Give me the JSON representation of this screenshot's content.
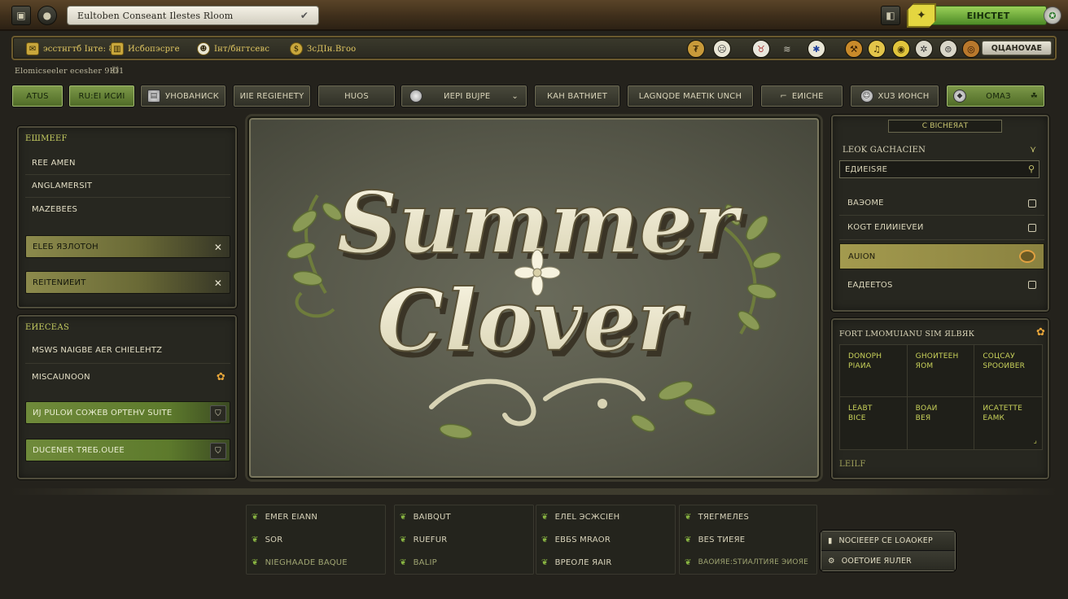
{
  "topbar": {
    "address": "Eultoben Conseant Ilestes Rloom",
    "action_button": "ЕІНСТЕТ",
    "close_glyph": "✪"
  },
  "resources": {
    "items": [
      "эсстнгтб Інте: 8",
      "Иcбопэсрге",
      "Інт/бнгтсевс",
      "ЗсДІн.Вгоо"
    ],
    "right_button": "QЦAНОVAЕ"
  },
  "breadcrumb": "Elomicseeler ecesher 9Ю1",
  "toolbar": {
    "buttons": [
      "AТUS",
      "RU:EI ИСИI",
      "УНОВАНИСК",
      "ИIE REGIEHETY",
      "НUOS",
      "ИЕРІ ВUЈРЕ",
      "КАН ВАТНИЕТ",
      "LAGNQDE MAETIK UNCH",
      "EИІСНЕ",
      "ХUЗ ИОНСН",
      "ОМАЗ"
    ]
  },
  "left_top": {
    "title": "EШМЕEF",
    "items": [
      "REE AMEN",
      "ANGLAMERSIT",
      "MAZEBEES"
    ],
    "bars": [
      "ELEБ ЯЗЛОТОН",
      "REIТENИЕИТ"
    ]
  },
  "left_bottom": {
    "title": "ЕИЕСЕАS",
    "items": [
      "MSWS NAIGBE AER CHIЕLЕНТZ",
      "MISCAUNOON"
    ],
    "bars": [
      "ИJ РULОИ СОЖЕВ ОРТЕНV SUITE",
      "DUCENER ТЯЕБ.OUЕE"
    ]
  },
  "logo": {
    "line1": "Summer",
    "line2": "Clover"
  },
  "right_panel": {
    "header": "С ВІСНЕЯАТ",
    "title": "LEOK GACHACIEN",
    "search": "EДИЕІSЯЕ",
    "items": [
      "ВАЭОМЕ",
      "КОGТ ЕЛИИІЕVЕИ",
      "AUION",
      "ЕАДЕЕТОS"
    ],
    "section_title": "FОRТ LMOMUIANU SIM ЯLBЯК",
    "grid": [
      [
        "DONOPH",
        "PIAИA"
      ],
      [
        "GНОИТЕЕН",
        "ЯОМ"
      ],
      [
        "СОЦСАУ",
        "SРООИВЕR"
      ],
      [
        "LЕАВТ",
        "ВІСЕ"
      ],
      [
        "ВОАИ",
        "ВЕЯ"
      ],
      [
        "ИСАТЕТТЕ",
        "ЕАМК"
      ]
    ],
    "footer": "LEILF"
  },
  "bottom": {
    "columns": [
      [
        "EMER EIANN",
        "SOR",
        "NIEGHAADE BAQUE"
      ],
      [
        "BAIBQUT",
        "RUEFUR",
        "BALIP"
      ],
      [
        "ЕЛЕL ЭСЖСІЕН",
        "ЕВБS MRAОR",
        "ВРЕОЛЕ ЯAIR"
      ],
      [
        "ТЯЕГМЕЛЕS",
        "ВЕS ТИЕЯЕ",
        "ВАОИЯЕ:STИАЛТИЯЕ ЭИОЯЕ"
      ]
    ],
    "popup": [
      "NOCIЕЕЕР СЕ LОАОКЕР",
      "ООЕТОИЕ ЯUЛЕR"
    ]
  }
}
